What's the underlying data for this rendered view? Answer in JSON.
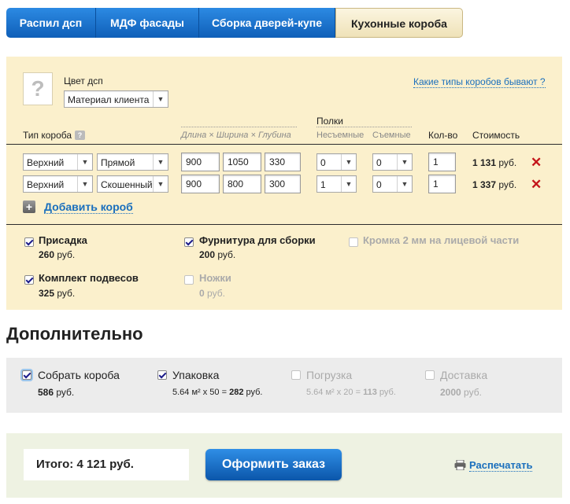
{
  "tabs": [
    {
      "label": "Распил дсп",
      "active": false
    },
    {
      "label": "МДФ фасады",
      "active": false
    },
    {
      "label": "Сборка дверей-купе",
      "active": false
    },
    {
      "label": "Кухонные короба",
      "active": true
    }
  ],
  "material": {
    "label": "Цвет дсп",
    "select_value": "Материал клиента",
    "help_link": "Какие типы коробов бывают ?",
    "placeholder_glyph": "?"
  },
  "table": {
    "col_type": "Тип короба",
    "col_type_help": "?",
    "col_dims": "Длина × Ширина × Глубина",
    "col_shelves": "Полки",
    "col_fixed": "Несъемные",
    "col_removable": "Съемные",
    "col_qty": "Кол-во",
    "col_cost": "Стоимость",
    "currency": "руб.",
    "rows": [
      {
        "type": "Верхний",
        "shape": "Прямой",
        "length": "900",
        "width": "1050",
        "depth": "330",
        "fixed": "0",
        "removable": "0",
        "qty": "1",
        "cost": "1 131"
      },
      {
        "type": "Верхний",
        "shape": "Скошенный",
        "length": "900",
        "width": "800",
        "depth": "300",
        "fixed": "1",
        "removable": "0",
        "qty": "1",
        "cost": "1 337"
      }
    ],
    "add_label": "Добавить короб"
  },
  "options": {
    "prisadka": {
      "label": "Присадка",
      "price": "260",
      "checked": true
    },
    "furnitura": {
      "label": "Фурнитура для сборки",
      "price": "200",
      "checked": true
    },
    "kromka": {
      "label": "Кромка 2 мм на лицевой части",
      "checked": false
    },
    "podvesy": {
      "label": "Комплект подвесов",
      "price": "325",
      "checked": true
    },
    "nozhki": {
      "label": "Ножки",
      "price": "0",
      "checked": false
    },
    "currency": "руб."
  },
  "extras": {
    "title": "Дополнительно",
    "sobrat": {
      "label": "Собрать короба",
      "price": "586",
      "checked": true
    },
    "upakovka": {
      "label": "Упаковка",
      "formula": "5.64 м² х 50 =",
      "price": "282",
      "checked": true
    },
    "pogruzka": {
      "label": "Погрузка",
      "formula": "5.64 м² х 20 =",
      "price": "113",
      "checked": false
    },
    "dostavka": {
      "label": "Доставка",
      "price": "2000",
      "checked": false
    },
    "currency": "руб."
  },
  "footer": {
    "total": "Итого: 4 121 руб.",
    "order_button": "Оформить заказ",
    "print_link": "Распечатать"
  },
  "colors": {
    "accent": "#1a6fbd",
    "delete": "#c4151a",
    "panel": "#fbf0cc"
  }
}
